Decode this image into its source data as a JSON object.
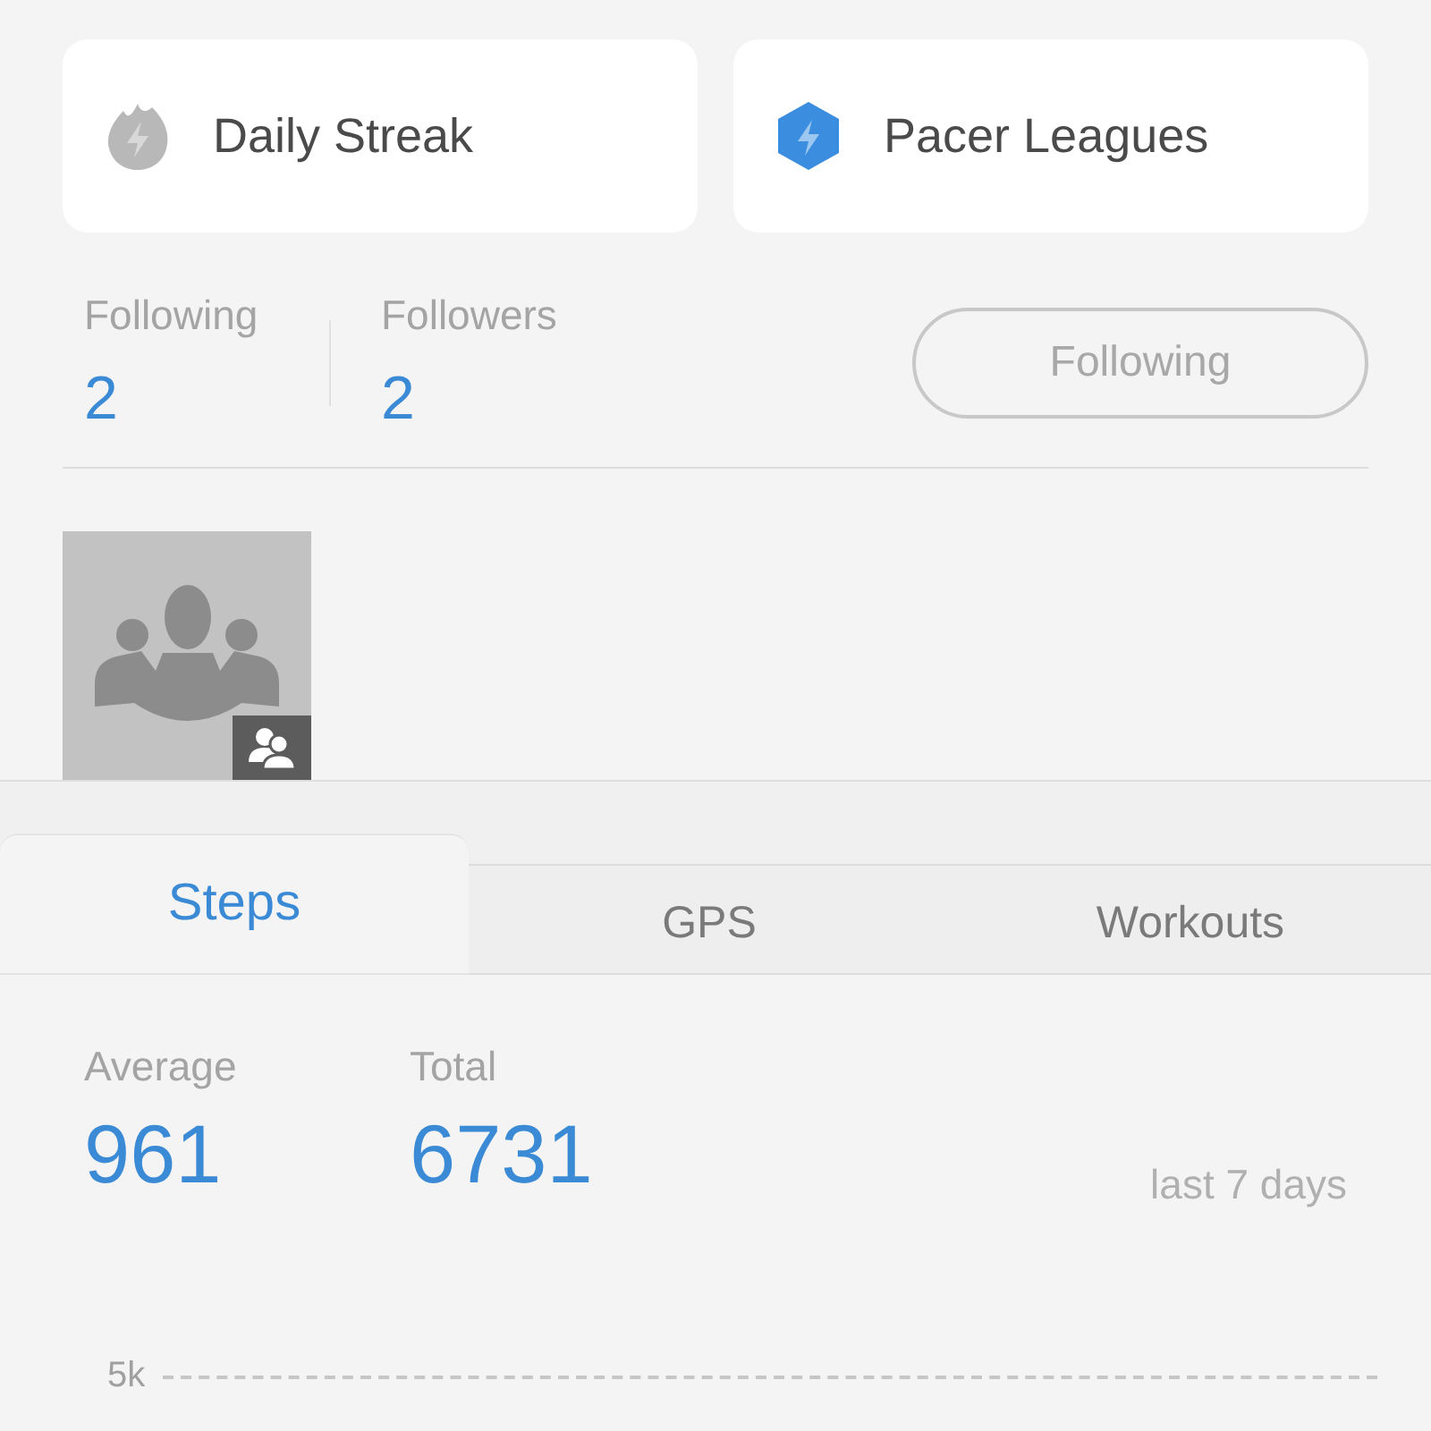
{
  "shortcuts": [
    {
      "kind": "flame",
      "label": "Daily Streak"
    },
    {
      "kind": "hexagon",
      "label": "Pacer Leagues"
    }
  ],
  "social": {
    "stats": [
      {
        "label": "Following",
        "value": "2"
      },
      {
        "label": "Followers",
        "value": "2"
      }
    ],
    "button": "Following"
  },
  "tabs": [
    {
      "label": "Steps",
      "selected": true
    },
    {
      "label": "GPS",
      "selected": false
    },
    {
      "label": "Workouts",
      "selected": false
    }
  ],
  "summary": {
    "stats": [
      {
        "label": "Average",
        "value": "961"
      },
      {
        "label": "Total",
        "value": "6731"
      }
    ],
    "period": "last 7 days"
  },
  "chart": {
    "gridline_label": "5k"
  }
}
